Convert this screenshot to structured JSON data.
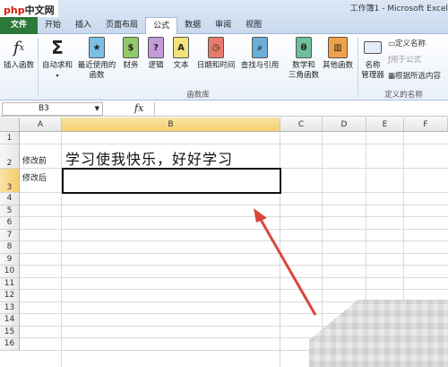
{
  "logo": {
    "brand": "php",
    "suffix": "中文网"
  },
  "window": {
    "title": "工作簿1 - Microsoft Excel"
  },
  "tabs": [
    "文件",
    "开始",
    "插入",
    "页面布局",
    "公式",
    "数据",
    "审阅",
    "视图"
  ],
  "ribbon": {
    "insert_function": "插入函数",
    "autosum": "自动求和",
    "recent_line1": "最近使用的",
    "recent_line2": "函数",
    "finance": "财务",
    "logic": "逻辑",
    "text": "文本",
    "datetime": "日期和时间",
    "lookup": "查找与引用",
    "math_line1": "数学和",
    "math_line2": "三角函数",
    "other": "其他函数",
    "name_mgr_line1": "名称",
    "name_mgr_line2": "管理器",
    "define_name": "定义名称",
    "use_in_formula": "用于公式",
    "create_from_sel": "根据所选内容",
    "group_library": "函数库",
    "group_names": "定义的名称"
  },
  "formula_bar": {
    "name_box": "B3",
    "fx": "fx",
    "value": ""
  },
  "columns": [
    "A",
    "B",
    "C",
    "D",
    "E",
    "F"
  ],
  "rows": [
    "1",
    "2",
    "3",
    "4",
    "5",
    "6",
    "7",
    "8",
    "9",
    "10",
    "11",
    "12",
    "13",
    "14",
    "15",
    "16"
  ],
  "cells": {
    "a2": "修改前",
    "b2": "学习使我快乐，好好学习",
    "a3": "修改后",
    "b3": ""
  },
  "colors": {
    "file_tab": "#2b7a3a",
    "selected_header": "#f5cf6d",
    "arrow": "#d9473a"
  }
}
